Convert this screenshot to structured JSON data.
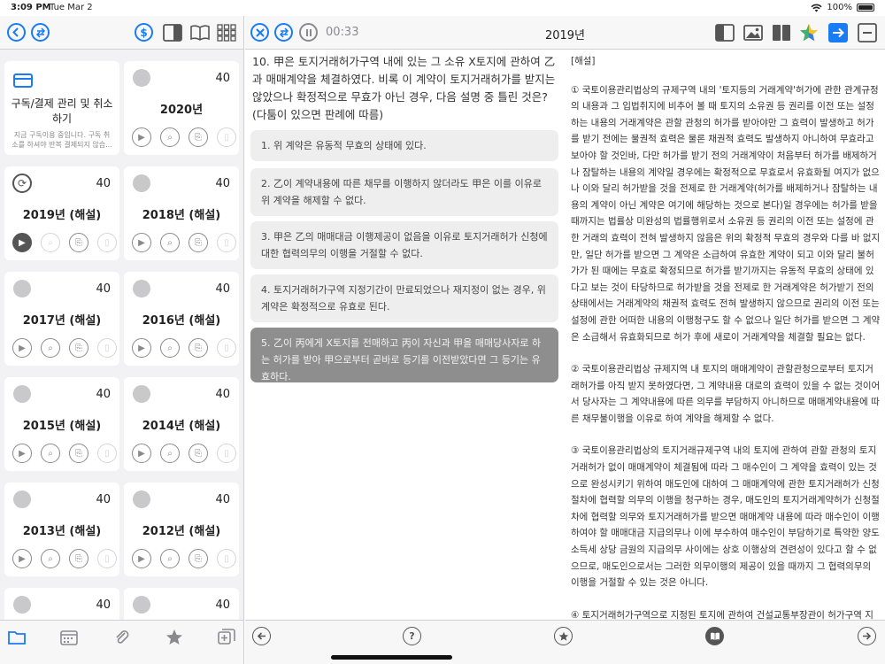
{
  "status": {
    "time": "3:09 PM",
    "date": "Tue Mar 2",
    "battery": "100%"
  },
  "left_toolbar": {
    "icons": [
      "back-icon",
      "swap-icon",
      "dollar-icon",
      "sidebar-icon",
      "book-icon",
      "grid-icon"
    ],
    "dollar_glyph": "$"
  },
  "subscription": {
    "title": "구독/결제 관리 및 취소하기",
    "desc": "지금 구독이용 중입니다. 구독 취소를 하셔야 반복 결제되지 않습..."
  },
  "cards": [
    {
      "title": "2020년",
      "count": "40"
    },
    {
      "title": "2019년 (해설)",
      "count": "40"
    },
    {
      "title": "2018년 (해설)",
      "count": "40"
    },
    {
      "title": "2017년 (해설)",
      "count": "40"
    },
    {
      "title": "2016년 (해설)",
      "count": "40"
    },
    {
      "title": "2015년 (해설)",
      "count": "40"
    },
    {
      "title": "2014년 (해설)",
      "count": "40"
    },
    {
      "title": "2013년 (해설)",
      "count": "40"
    },
    {
      "title": "2012년 (해설)",
      "count": "40"
    },
    {
      "title": "",
      "count": "40"
    },
    {
      "title": "",
      "count": "40"
    }
  ],
  "right_toolbar": {
    "timer": "00:33",
    "title": "2019년"
  },
  "question": {
    "text": "10. 甲은 토지거래허가구역 내에 있는 그 소유 X토지에 관하여 乙과 매매계약을 체결하였다. 비록 이 계약이 토지거래허가를 받지는 않았으나 확정적으로 무효가 아닌 경우, 다음 설명 중 틀린 것은? (다툼이 있으면 판례에 따름)",
    "choices": [
      "1. 위 계약은 유동적 무효의 상태에 있다.",
      "2. 乙이 계약내용에 따른 채무를 이행하지 않더라도 甲은 이를 이유로 위 계약을 해제할 수 없다.",
      "3. 甲은 乙의 매매대금 이행제공이 없음을 이유로 토지거래허가 신청에 대한 협력의무의 이행을 거절할 수 없다.",
      "4. 토지거래허가구역 지정기간이 만료되었으나 재지정이 없는 경우, 위 계약은 확정적으로 유효로 된다.",
      "5. 乙이 丙에게 X토지를 전매하고 丙이 자신과 甲을 매매당사자로 하는 허가를 받아 甲으로부터 곧바로 등기를 이전받았다면 그 등기는 유효하다."
    ],
    "selected": 4
  },
  "explanation": {
    "head": "[해설]",
    "paragraphs": [
      "① 국토이용관리법상의 규제구역 내의 '토지등의 거래계약'허가에 관한 관계규정의 내용과 그 입법취지에 비추어 볼 때 토지의 소유권 등 권리를 이전 또는 설정하는 내용의 거래계약은 관할 관청의 허가를 받아야만 그 효력이 발생하고 허가를 받기 전에는 물권적 효력은 물론 채권적 효력도 발생하지 아니하여 무효라고 보아야 할 것인바, 다만 허가를 받기 전의 거래계약이 처음부터 허가를 배제하거나 잠탈하는 내용의 계약일 경우에는 확정적으로 무효로서 유효화될 여지가 없으나 이와 달리 허가받을 것을 전제로 한 거래계약(허가를 배제하거나 잠탈하는 내용의 계약이 아닌 계약은 여기에 해당하는 것으로 본다)일 경우에는 허가를 받을 때까지는 법률상 미완성의 법률행위로서 소유권 등 권리의 이전 또는 설정에 관한 거래의 효력이 전혀 발생하지 않음은 위의 확정적 무효의 경우와 다를 바 없지만, 일단 허가를 받으면 그 계약은 소급하여 유효한 계약이 되고 이와 달리 불허가가 된 때에는 무효로 확정되므로 허가를 받기까지는 유동적 무효의 상태에 있다고 보는 것이 타당하므로 허가받을 것을 전제로 한 거래계약은 허가받기 전의 상태에서는 거래계약의 채권적 효력도 전혀 발생하지 않으므로 권리의 이전 또는 설정에 관한 어떠한 내용의 이행청구도 할 수 없으나 일단 허가를 받으면 그 계약은 소급해서 유효화되므로 허가 후에 새로이 거래계약을 체결할 필요는 없다.",
      "② 국토이용관리법상 규제지역 내 토지의 매매계약이 관할관청으로부터 토지거래허가를 아직 받지 못하였다면, 그 계약내용 대로의 효력이 있을 수 없는 것이어서 당사자는 그 계약내용에 따른 의무를 부담하지 아니하므로 매매계약내용에 따른 채무불이행을 이유로 하여 계약을 해제할 수 없다.",
      "③ 국토이용관리법상의 토지거래규제구역 내의 토지에 관하여 관할 관청의 토지거래허가 없이 매매계약이 체결됨에 따라 그 매수인이 그 계약을 효력이 있는 것으로 완성시키기 위하여 매도인에 대하여 그 매매계약에 관한 토지거래허가 신청절차에 협력할 의무의 이행을 청구하는 경우, 매도인의 토지거래계약허가 신청절차에 협력할 의무와 토지거래허가를 받으면 매매계약 내용에 따라 매수인이 이행하여야 할 매매대금 지급의무나 이에 부수하여 매수인이 부담하기로 특약한 양도소득세 상당 금원의 지급의무 사이에는 상호 이행상의 견련성이 있다고 할 수 없으므로, 매도인으로서는 그러한 의무이행의 제공이 있을 때까지 그 협력의무의 이행을 거절할 수 있는 것은 아니다.",
      "④ 토지거래허가구역으로 지정된 토지에 관하여 건설교통부장관이 허가구역 지정을 해제하거나, 또는 허가구역 지정기간이 만료되었음에도 허가구역 재지정을 하지 아니한(이하 '허가구역 지정해제 등'이라고 한다) 취지는 당"
    ]
  },
  "right_toolbar_icons": [
    "close-icon",
    "swap-icon",
    "pause-icon",
    "sidebar-icon",
    "image-icon",
    "split-icon",
    "star-color-icon",
    "arrow-right-icon",
    "minus-icon"
  ],
  "left_tabs": [
    "folder-icon",
    "calendar-icon",
    "paperclip-icon",
    "star-icon",
    "add-copy-icon"
  ],
  "bottom_nav": {
    "help_glyph": "?",
    "bottom_icons": [
      "prev-icon",
      "help-icon",
      "star-outline-icon",
      "book-icon",
      "next-icon"
    ]
  },
  "colors": {
    "accent": "#1a7cf2",
    "selected_choice": "#8e8e8e",
    "choice_bg": "#eeeeef",
    "pane_bg": "#f2f2f4"
  }
}
